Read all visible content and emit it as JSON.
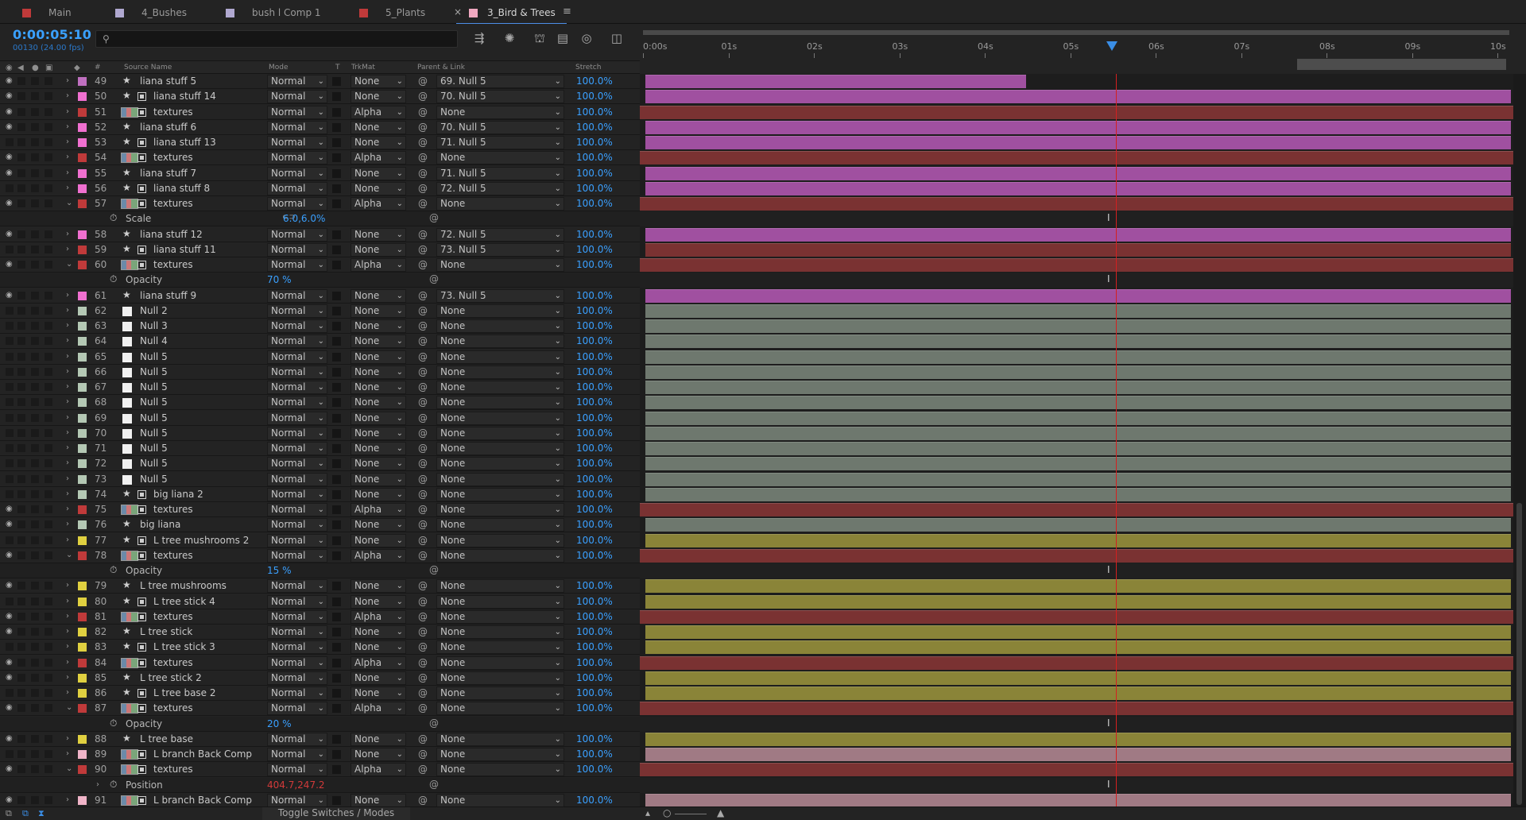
{
  "tabs": [
    {
      "label": "Main",
      "color": "#c03a3a"
    },
    {
      "label": "4_Bushes",
      "color": "#b0a8d0"
    },
    {
      "label": "bush l Comp 1",
      "color": "#b0a8d0"
    },
    {
      "label": "5_Plants",
      "color": "#c03a3a"
    },
    {
      "label": "3_Bird & Trees",
      "color": "#f0a8c0",
      "active": true
    }
  ],
  "tab_close": "×",
  "tab_menu": "≡",
  "timecode": "0:00:05:10",
  "frame_info": "00130 (24.00 fps)",
  "search": {
    "placeholder": "",
    "icon": "search-icon"
  },
  "toolbar_icons": [
    "comp-flowchart-icon",
    "draft-3d-icon",
    "shy-icon",
    "frame-blending-icon",
    "motion-blur-icon",
    "graph-editor-icon"
  ],
  "columns": {
    "source_name": "Source Name",
    "mode": "Mode",
    "t": "T",
    "trkmat": "TrkMat",
    "parent": "Parent & Link",
    "stretch": "Stretch",
    "num": "#"
  },
  "ruler": [
    "0:00s",
    "01s",
    "02s",
    "03s",
    "04s",
    "05s",
    "06s",
    "07s",
    "08s",
    "09s",
    "10s"
  ],
  "layers": [
    {
      "num": "49",
      "name": "liana stuff 5",
      "label": "#c070c0",
      "icon": "star",
      "eye": true,
      "expanded": false,
      "mode": "Normal",
      "trk": "None",
      "parent": "69. Null 5",
      "stretch": "100.0%",
      "bar": "#a050a0",
      "bar_start": 0.0,
      "bar_end": 0.44
    },
    {
      "num": "50",
      "name": "liana stuff 14",
      "label": "#f070d0",
      "icon": "star-box",
      "eye": true,
      "expanded": false,
      "mode": "Normal",
      "trk": "None",
      "parent": "70. Null 5",
      "stretch": "100.0%",
      "bar": "#a050a0",
      "bar_start": 0.0,
      "bar_end": 1.0
    },
    {
      "num": "51",
      "name": "textures",
      "label": "#c03a3a",
      "icon": "comp",
      "eye": true,
      "expanded": false,
      "mode": "Normal",
      "trk": "Alpha",
      "parent": "None",
      "stretch": "100.0%",
      "bar": "#7a3232",
      "bar_start": -0.01,
      "bar_end": 1.01
    },
    {
      "num": "52",
      "name": "liana stuff 6",
      "label": "#f070d0",
      "icon": "star",
      "eye": true,
      "expanded": false,
      "mode": "Normal",
      "trk": "None",
      "parent": "70. Null 5",
      "stretch": "100.0%",
      "bar": "#a050a0",
      "bar_start": 0.0,
      "bar_end": 1.0
    },
    {
      "num": "53",
      "name": "liana stuff 13",
      "label": "#f070d0",
      "icon": "star-box",
      "eye": false,
      "expanded": false,
      "mode": "Normal",
      "trk": "None",
      "parent": "71. Null 5",
      "stretch": "100.0%",
      "bar": "#a050a0",
      "bar_start": 0.0,
      "bar_end": 1.0
    },
    {
      "num": "54",
      "name": "textures",
      "label": "#c03a3a",
      "icon": "comp",
      "eye": true,
      "expanded": false,
      "mode": "Normal",
      "trk": "Alpha",
      "parent": "None",
      "stretch": "100.0%",
      "bar": "#7a3232",
      "bar_start": -0.01,
      "bar_end": 1.01
    },
    {
      "num": "55",
      "name": "liana stuff 7",
      "label": "#f070d0",
      "icon": "star",
      "eye": true,
      "expanded": false,
      "mode": "Normal",
      "trk": "None",
      "parent": "71. Null 5",
      "stretch": "100.0%",
      "bar": "#a050a0",
      "bar_start": 0.0,
      "bar_end": 1.0
    },
    {
      "num": "56",
      "name": "liana stuff 8",
      "label": "#f070d0",
      "icon": "star-box",
      "eye": false,
      "expanded": false,
      "mode": "Normal",
      "trk": "None",
      "parent": "72. Null 5",
      "stretch": "100.0%",
      "bar": "#a050a0",
      "bar_start": 0.0,
      "bar_end": 1.0
    },
    {
      "num": "57",
      "name": "textures",
      "label": "#c03a3a",
      "icon": "comp",
      "eye": true,
      "expanded": true,
      "mode": "Normal",
      "trk": "Alpha",
      "parent": "None",
      "stretch": "100.0%",
      "bar": "#7a3232",
      "bar_start": -0.01,
      "bar_end": 1.01,
      "prop": {
        "name": "Scale",
        "value": "6.0,6.0%",
        "red": false,
        "link": true
      }
    },
    {
      "num": "58",
      "name": "liana stuff 12",
      "label": "#f070d0",
      "icon": "star",
      "eye": true,
      "expanded": false,
      "mode": "Normal",
      "trk": "None",
      "parent": "72. Null 5",
      "stretch": "100.0%",
      "bar": "#a050a0",
      "bar_start": 0.0,
      "bar_end": 1.0
    },
    {
      "num": "59",
      "name": "liana stuff 11",
      "label": "#c03a3a",
      "icon": "star-box",
      "eye": false,
      "expanded": false,
      "mode": "Normal",
      "trk": "None",
      "parent": "73. Null 5",
      "stretch": "100.0%",
      "bar": "#7a3232",
      "bar_start": 0.0,
      "bar_end": 1.0
    },
    {
      "num": "60",
      "name": "textures",
      "label": "#c03a3a",
      "icon": "comp",
      "eye": true,
      "expanded": true,
      "mode": "Normal",
      "trk": "Alpha",
      "parent": "None",
      "stretch": "100.0%",
      "bar": "#7a3232",
      "bar_start": -0.01,
      "bar_end": 1.01,
      "prop": {
        "name": "Opacity",
        "value": "70 %",
        "red": false,
        "link": false
      }
    },
    {
      "num": "61",
      "name": "liana stuff 9",
      "label": "#f070d0",
      "icon": "star",
      "eye": true,
      "expanded": false,
      "mode": "Normal",
      "trk": "None",
      "parent": "73. Null 5",
      "stretch": "100.0%",
      "bar": "#a050a0",
      "bar_start": 0.0,
      "bar_end": 1.0
    },
    {
      "num": "62",
      "name": "Null 2",
      "label": "#b4c8b4",
      "icon": "null",
      "eye": false,
      "expanded": false,
      "mode": "Normal",
      "trk": "None",
      "parent": "None",
      "stretch": "100.0%",
      "bar": "#6e786e",
      "bar_start": 0.0,
      "bar_end": 1.0
    },
    {
      "num": "63",
      "name": "Null 3",
      "label": "#b4c8b4",
      "icon": "null",
      "eye": false,
      "expanded": false,
      "mode": "Normal",
      "trk": "None",
      "parent": "None",
      "stretch": "100.0%",
      "bar": "#6e786e",
      "bar_start": 0.0,
      "bar_end": 1.0
    },
    {
      "num": "64",
      "name": "Null 4",
      "label": "#b4c8b4",
      "icon": "null",
      "eye": false,
      "expanded": false,
      "mode": "Normal",
      "trk": "None",
      "parent": "None",
      "stretch": "100.0%",
      "bar": "#6e786e",
      "bar_start": 0.0,
      "bar_end": 1.0
    },
    {
      "num": "65",
      "name": "Null 5",
      "label": "#b4c8b4",
      "icon": "null",
      "eye": false,
      "expanded": false,
      "mode": "Normal",
      "trk": "None",
      "parent": "None",
      "stretch": "100.0%",
      "bar": "#6e786e",
      "bar_start": 0.0,
      "bar_end": 1.0
    },
    {
      "num": "66",
      "name": "Null 5",
      "label": "#b4c8b4",
      "icon": "null",
      "eye": false,
      "expanded": false,
      "mode": "Normal",
      "trk": "None",
      "parent": "None",
      "stretch": "100.0%",
      "bar": "#6e786e",
      "bar_start": 0.0,
      "bar_end": 1.0
    },
    {
      "num": "67",
      "name": "Null 5",
      "label": "#b4c8b4",
      "icon": "null",
      "eye": false,
      "expanded": false,
      "mode": "Normal",
      "trk": "None",
      "parent": "None",
      "stretch": "100.0%",
      "bar": "#6e786e",
      "bar_start": 0.0,
      "bar_end": 1.0
    },
    {
      "num": "68",
      "name": "Null 5",
      "label": "#b4c8b4",
      "icon": "null",
      "eye": false,
      "expanded": false,
      "mode": "Normal",
      "trk": "None",
      "parent": "None",
      "stretch": "100.0%",
      "bar": "#6e786e",
      "bar_start": 0.0,
      "bar_end": 1.0
    },
    {
      "num": "69",
      "name": "Null 5",
      "label": "#b4c8b4",
      "icon": "null",
      "eye": false,
      "expanded": false,
      "mode": "Normal",
      "trk": "None",
      "parent": "None",
      "stretch": "100.0%",
      "bar": "#6e786e",
      "bar_start": 0.0,
      "bar_end": 1.0
    },
    {
      "num": "70",
      "name": "Null 5",
      "label": "#b4c8b4",
      "icon": "null",
      "eye": false,
      "expanded": false,
      "mode": "Normal",
      "trk": "None",
      "parent": "None",
      "stretch": "100.0%",
      "bar": "#6e786e",
      "bar_start": 0.0,
      "bar_end": 1.0
    },
    {
      "num": "71",
      "name": "Null 5",
      "label": "#b4c8b4",
      "icon": "null",
      "eye": false,
      "expanded": false,
      "mode": "Normal",
      "trk": "None",
      "parent": "None",
      "stretch": "100.0%",
      "bar": "#6e786e",
      "bar_start": 0.0,
      "bar_end": 1.0
    },
    {
      "num": "72",
      "name": "Null 5",
      "label": "#b4c8b4",
      "icon": "null",
      "eye": false,
      "expanded": false,
      "mode": "Normal",
      "trk": "None",
      "parent": "None",
      "stretch": "100.0%",
      "bar": "#6e786e",
      "bar_start": 0.0,
      "bar_end": 1.0
    },
    {
      "num": "73",
      "name": "Null 5",
      "label": "#b4c8b4",
      "icon": "null",
      "eye": false,
      "expanded": false,
      "mode": "Normal",
      "trk": "None",
      "parent": "None",
      "stretch": "100.0%",
      "bar": "#6e786e",
      "bar_start": 0.0,
      "bar_end": 1.0
    },
    {
      "num": "74",
      "name": "big liana 2",
      "label": "#b4c8b4",
      "icon": "star-box",
      "eye": false,
      "expanded": false,
      "mode": "Normal",
      "trk": "None",
      "parent": "None",
      "stretch": "100.0%",
      "bar": "#6e786e",
      "bar_start": 0.0,
      "bar_end": 1.0
    },
    {
      "num": "75",
      "name": "textures",
      "label": "#c03a3a",
      "icon": "comp",
      "eye": true,
      "expanded": false,
      "mode": "Normal",
      "trk": "Alpha",
      "parent": "None",
      "stretch": "100.0%",
      "bar": "#7a3232",
      "bar_start": -0.01,
      "bar_end": 1.01
    },
    {
      "num": "76",
      "name": "big liana",
      "label": "#b4c8b4",
      "icon": "star",
      "eye": true,
      "expanded": false,
      "mode": "Normal",
      "trk": "None",
      "parent": "None",
      "stretch": "100.0%",
      "bar": "#6e786e",
      "bar_start": 0.0,
      "bar_end": 1.0
    },
    {
      "num": "77",
      "name": "L tree mushrooms 2",
      "label": "#e0d040",
      "icon": "star-box",
      "eye": false,
      "expanded": false,
      "mode": "Normal",
      "trk": "None",
      "parent": "None",
      "stretch": "100.0%",
      "bar": "#8a8438",
      "bar_start": 0.0,
      "bar_end": 1.0
    },
    {
      "num": "78",
      "name": "textures",
      "label": "#c03a3a",
      "icon": "comp",
      "eye": true,
      "expanded": true,
      "mode": "Normal",
      "trk": "Alpha",
      "parent": "None",
      "stretch": "100.0%",
      "bar": "#7a3232",
      "bar_start": -0.01,
      "bar_end": 1.01,
      "prop": {
        "name": "Opacity",
        "value": "15 %",
        "red": false,
        "link": false
      }
    },
    {
      "num": "79",
      "name": "L tree mushrooms",
      "label": "#e0d040",
      "icon": "star",
      "eye": true,
      "expanded": false,
      "mode": "Normal",
      "trk": "None",
      "parent": "None",
      "stretch": "100.0%",
      "bar": "#8a8438",
      "bar_start": 0.0,
      "bar_end": 1.0
    },
    {
      "num": "80",
      "name": "L tree stick 4",
      "label": "#e0d040",
      "icon": "star-box",
      "eye": false,
      "expanded": false,
      "mode": "Normal",
      "trk": "None",
      "parent": "None",
      "stretch": "100.0%",
      "bar": "#8a8438",
      "bar_start": 0.0,
      "bar_end": 1.0
    },
    {
      "num": "81",
      "name": "textures",
      "label": "#c03a3a",
      "icon": "comp",
      "eye": true,
      "expanded": false,
      "mode": "Normal",
      "trk": "Alpha",
      "parent": "None",
      "stretch": "100.0%",
      "bar": "#7a3232",
      "bar_start": -0.01,
      "bar_end": 1.01
    },
    {
      "num": "82",
      "name": "L tree stick",
      "label": "#e0d040",
      "icon": "star",
      "eye": true,
      "expanded": false,
      "mode": "Normal",
      "trk": "None",
      "parent": "None",
      "stretch": "100.0%",
      "bar": "#8a8438",
      "bar_start": 0.0,
      "bar_end": 1.0
    },
    {
      "num": "83",
      "name": "L tree stick 3",
      "label": "#e0d040",
      "icon": "star-box",
      "eye": false,
      "expanded": false,
      "mode": "Normal",
      "trk": "None",
      "parent": "None",
      "stretch": "100.0%",
      "bar": "#8a8438",
      "bar_start": 0.0,
      "bar_end": 1.0
    },
    {
      "num": "84",
      "name": "textures",
      "label": "#c03a3a",
      "icon": "comp",
      "eye": true,
      "expanded": false,
      "mode": "Normal",
      "trk": "Alpha",
      "parent": "None",
      "stretch": "100.0%",
      "bar": "#7a3232",
      "bar_start": -0.01,
      "bar_end": 1.01
    },
    {
      "num": "85",
      "name": "L tree stick 2",
      "label": "#e0d040",
      "icon": "star",
      "eye": true,
      "expanded": false,
      "mode": "Normal",
      "trk": "None",
      "parent": "None",
      "stretch": "100.0%",
      "bar": "#8a8438",
      "bar_start": 0.0,
      "bar_end": 1.0
    },
    {
      "num": "86",
      "name": "L tree base 2",
      "label": "#e0d040",
      "icon": "star-box",
      "eye": false,
      "expanded": false,
      "mode": "Normal",
      "trk": "None",
      "parent": "None",
      "stretch": "100.0%",
      "bar": "#8a8438",
      "bar_start": 0.0,
      "bar_end": 1.0
    },
    {
      "num": "87",
      "name": "textures",
      "label": "#c03a3a",
      "icon": "comp",
      "eye": true,
      "expanded": true,
      "mode": "Normal",
      "trk": "Alpha",
      "parent": "None",
      "stretch": "100.0%",
      "bar": "#7a3232",
      "bar_start": -0.01,
      "bar_end": 1.01,
      "prop": {
        "name": "Opacity",
        "value": "20 %",
        "red": false,
        "link": false
      }
    },
    {
      "num": "88",
      "name": "L tree base",
      "label": "#e0d040",
      "icon": "star",
      "eye": true,
      "expanded": false,
      "mode": "Normal",
      "trk": "None",
      "parent": "None",
      "stretch": "100.0%",
      "bar": "#8a8438",
      "bar_start": 0.0,
      "bar_end": 1.0
    },
    {
      "num": "89",
      "name": "L branch Back Comp",
      "label": "#f0b4c8",
      "icon": "comp",
      "eye": false,
      "expanded": false,
      "mode": "Normal",
      "trk": "None",
      "parent": "None",
      "stretch": "100.0%",
      "bar": "#a07a84",
      "bar_start": 0.0,
      "bar_end": 1.0
    },
    {
      "num": "90",
      "name": "textures",
      "label": "#c03a3a",
      "icon": "comp",
      "eye": true,
      "expanded": true,
      "mode": "Normal",
      "trk": "Alpha",
      "parent": "None",
      "stretch": "100.0%",
      "bar": "#7a3232",
      "bar_start": -0.01,
      "bar_end": 1.01,
      "prop": {
        "name": "Position",
        "value": "404.7,247.2",
        "red": true,
        "link": false,
        "subarrow": true
      }
    },
    {
      "num": "91",
      "name": "L branch Back Comp",
      "label": "#f0b4c8",
      "icon": "comp",
      "eye": true,
      "expanded": false,
      "mode": "Normal",
      "trk": "None",
      "parent": "None",
      "stretch": "100.0%",
      "bar": "#a07a84",
      "bar_start": 0.0,
      "bar_end": 1.0
    }
  ],
  "footer": {
    "toggle_label": "Toggle Switches / Modes"
  }
}
